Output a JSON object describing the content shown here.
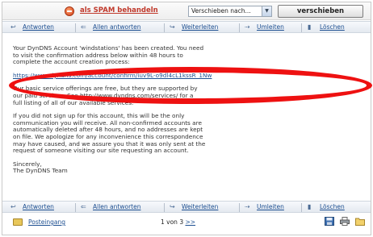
{
  "spam_bar": {
    "spam_label": "als SPAM behandeln",
    "move_select_value": "Verschieben nach...",
    "move_button": "verschieben"
  },
  "toolbar": {
    "reply": "Antworten",
    "reply_all": "Allen antworten",
    "forward": "Weiterleiten",
    "redirect": "Umleiten",
    "delete": "Löschen"
  },
  "message": {
    "p1": "Your DynDNS Account 'windstations' has been created.  You need\nto visit the confirmation address below within 48 hours to\ncomplete the account creation process:",
    "url": "https://www.dyndns.com/account/confirm/iuv9L-o9dl4cL1kssR_1Nw",
    "p2": "Our basic service offerings are free, but they are supported by\nour paid services.  See http://www.dyndns.com/services/ for a\nfull listing of all of our available services.",
    "p3": "If you did not sign up for this account, this will be the only\ncommunication you will receive.  All non-confirmed accounts are\nautomatically deleted after 48 hours, and no addresses are kept\non file. We apologize for any inconvenience this correspondence\nmay have caused, and we assure you that it was only sent at the\nrequest of someone visiting our site requesting an account.",
    "p4": "Sincerely,\nThe DynDNS Team"
  },
  "bottom": {
    "inbox": "Posteingang",
    "pager_text": "1 von 3",
    "pager_next": ">>"
  },
  "icons": [
    "spam-icon",
    "reply-icon",
    "reply-all-icon",
    "forward-icon",
    "redirect-icon",
    "delete-icon",
    "inbox-icon",
    "save-icon",
    "print-icon",
    "folder-icon"
  ],
  "colors": {
    "link": "#1d4f91",
    "spam": "#c0392b",
    "highlight_circle": "#ee1111"
  }
}
